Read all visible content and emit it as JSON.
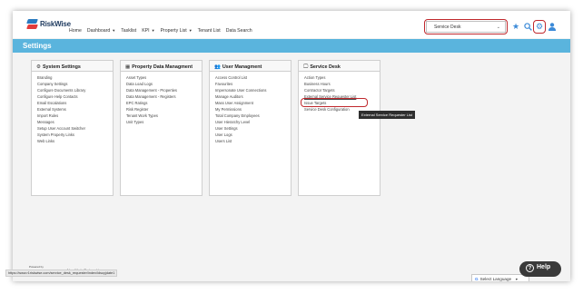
{
  "app": {
    "logo_text": "RiskWise"
  },
  "nav": [
    {
      "label": "Home",
      "caret": ""
    },
    {
      "label": "Dashboard",
      "caret": "▼"
    },
    {
      "label": "Tasklist",
      "caret": ""
    },
    {
      "label": "KPI",
      "caret": "▼"
    },
    {
      "label": "Property List",
      "caret": "▼"
    },
    {
      "label": "Tenant List",
      "caret": ""
    },
    {
      "label": "Data Search",
      "caret": ""
    }
  ],
  "module_select": {
    "value": "Service Desk",
    "chevron": "⌄"
  },
  "icons": {
    "star": "★",
    "gear": "⚙",
    "accent": "#3b8ad8"
  },
  "settings": {
    "title": "Settings",
    "bar_color": "#5ab4dd"
  },
  "cards": [
    {
      "title": "System Settings",
      "icon": "⚙",
      "items": [
        "Branding",
        "Company Settings",
        "Configure Documents Library",
        "Configure Help Contacts",
        "Email Escalations",
        "External Systems",
        "Import Rules",
        "Messages",
        "Setup User Account Switcher",
        "System Property Links",
        "Web Links"
      ]
    },
    {
      "title": "Property Data Managment",
      "icon": "▦",
      "items": [
        "Asset Types",
        "Data Load Logs",
        "Data Management - Properties",
        "Data Management - Registers",
        "EPC Ratings",
        "Risk Register",
        "Tenant Work Types",
        "Unit Types"
      ]
    },
    {
      "title": "User Managment",
      "icon": "👥",
      "items": [
        "Access Control List",
        "Favourites",
        "Impersonate User Connections",
        "Manage Auditors",
        "Mass User Assignment",
        "My Permissions",
        "Total Company Employees",
        "User Hierarchy Level",
        "User Settings",
        "User Logs",
        "Users List"
      ]
    },
    {
      "title": "Service Desk",
      "icon": "🖵",
      "items": [
        "Action Types",
        "Business Hours",
        "Contractor Targets",
        "External Service Requester List",
        "Issue Targets",
        "Service Desk Configuration"
      ]
    }
  ],
  "tooltip": "External Service Requester List",
  "footer": {
    "powered_by": "Powered by",
    "text": "Now We In Partnership",
    "status_url": "https://www.r1riskwise.com/service_desk_requester/index/idsuyjdate1"
  },
  "translate": {
    "g": "G",
    "label": "Select Language",
    "chevron": "▼"
  },
  "help": {
    "q": "?",
    "label": "Help"
  }
}
